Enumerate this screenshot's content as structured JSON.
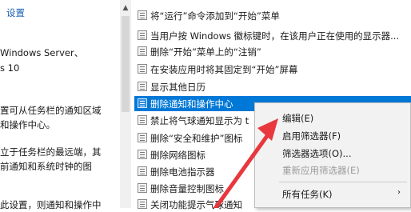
{
  "left_pane": {
    "lines": [
      "设置",
      "Windows Server、",
      "s 10",
      "置可从任务栏的通知区域",
      "和操作中心。",
      "立于任务栏的最远端，其",
      "前通知和系统时钟的图",
      "此设置，则通知和操作中"
    ]
  },
  "policy_list": {
    "items": [
      "将“运行”命令添加到“开始”菜单",
      "当用户按 Windows 徽标键时，在该用户正在使用的显示器...",
      "删除“开始”菜单上的“注销”",
      "在安装应用时将其固定到“开始”屏幕",
      "显示其他日历",
      "删除通知和操作中心",
      "禁止将气球通知显示为 t",
      "删除“安全和维护”图标",
      "删除网络图标",
      "删除电池指示器",
      "删除音量控制图标",
      "关闭功能提示气球通知"
    ],
    "selected_index": 5
  },
  "context_menu": {
    "items": [
      {
        "label": "编辑(E)",
        "enabled": true
      },
      {
        "label": "启用筛选器(F)",
        "enabled": true
      },
      {
        "label": "筛选器选项(O)...",
        "enabled": true
      },
      {
        "label": "重新应用筛选器(E)",
        "enabled": false
      },
      {
        "label": "所有任务(K)",
        "enabled": true,
        "has_submenu": true
      }
    ],
    "submenu_arrow": "›"
  },
  "colors": {
    "selection": "#0078d7",
    "annotation_arrow": "#e8383d"
  },
  "icons": {
    "policy_item": "policy-setting-icon",
    "scroll_up": "chevron-up-icon"
  }
}
